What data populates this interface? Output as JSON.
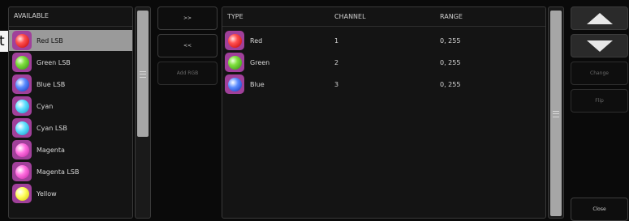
{
  "available": {
    "header": "AVAILABLE",
    "items": [
      {
        "label": "Red LSB",
        "selected": true,
        "border": "#a0409a",
        "ball": "radial-gradient(circle at 35% 35%, #ffe0e0 0%, #ff5050 35%, #c00000 100%)"
      },
      {
        "label": "Green LSB",
        "selected": false,
        "border": "#a0409a",
        "ball": "radial-gradient(circle at 35% 35%, #f0ffe0 0%, #80e040 35%, #2e8a10 100%)"
      },
      {
        "label": "Blue LSB",
        "selected": false,
        "border": "#a0409a",
        "ball": "radial-gradient(circle at 35% 35%, #ffffff 0%, #5a8cff 40%, #1030b0 100%)"
      },
      {
        "label": "Cyan",
        "selected": false,
        "border": "#a0409a",
        "ball": "radial-gradient(circle at 35% 35%, #ffffff 0%, #60e0ff 40%, #1090c0 100%)"
      },
      {
        "label": "Cyan LSB",
        "selected": false,
        "border": "#a0409a",
        "ball": "radial-gradient(circle at 35% 35%, #ffffff 0%, #60e0ff 40%, #1090c0 100%)"
      },
      {
        "label": "Magenta",
        "selected": false,
        "border": "#a0409a",
        "ball": "radial-gradient(circle at 35% 35%, #ffffff 0%, #ff70e0 40%, #c020a0 100%)"
      },
      {
        "label": "Magenta LSB",
        "selected": false,
        "border": "#a0409a",
        "ball": "radial-gradient(circle at 35% 35%, #ffffff 0%, #ff70e0 40%, #c020a0 100%)"
      },
      {
        "label": "Yellow",
        "selected": false,
        "border": "#a0409a",
        "ball": "radial-gradient(circle at 35% 35%, #ffffff 0%, #ffff60 40%, #d0c000 100%)"
      }
    ]
  },
  "middle_buttons": {
    "add": ">>",
    "remove": "<<",
    "add_rgb": "Add RGB"
  },
  "channels": {
    "headers": {
      "type": "TYPE",
      "channel": "CHANNEL",
      "range": "RANGE"
    },
    "rows": [
      {
        "type": "Red",
        "channel": "1",
        "range": "0, 255",
        "border": "#a0409a",
        "ball": "radial-gradient(circle at 35% 35%, #ffe0e0 0%, #ff5050 35%, #c00000 100%)"
      },
      {
        "type": "Green",
        "channel": "2",
        "range": "0, 255",
        "border": "#a0409a",
        "ball": "radial-gradient(circle at 35% 35%, #f0ffe0 0%, #80e040 35%, #2e8a10 100%)"
      },
      {
        "type": "Blue",
        "channel": "3",
        "range": "0, 255",
        "border": "#a0409a",
        "ball": "radial-gradient(circle at 35% 35%, #ffffff 0%, #5a8cff 40%, #1030b0 100%)"
      }
    ]
  },
  "right_buttons": {
    "up_icon": "triangle-up",
    "down_icon": "triangle-down",
    "change": "Change",
    "flip": "Flip",
    "close": "Close"
  },
  "stray_text": "t"
}
